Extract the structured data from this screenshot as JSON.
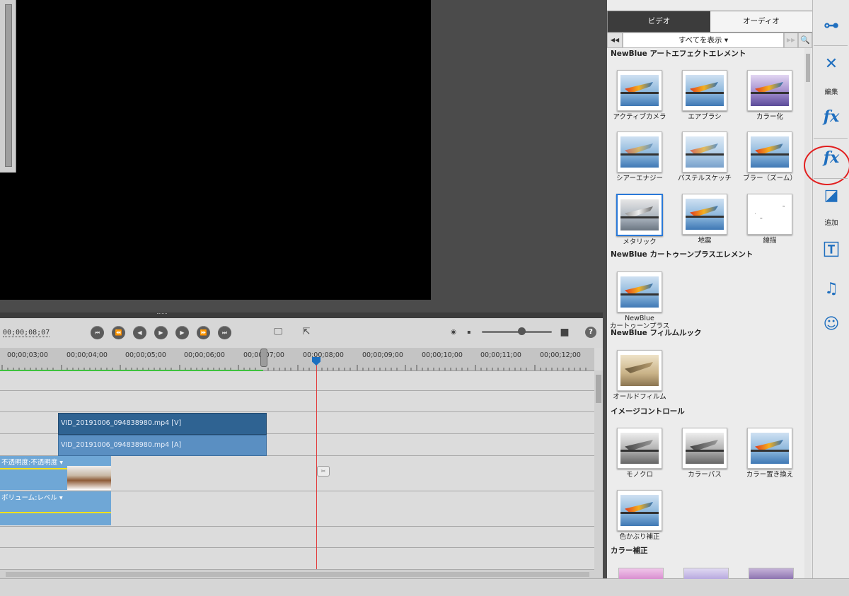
{
  "timecode": "00;00;08;07",
  "transport": {
    "buttons": [
      "⏮",
      "⏪",
      "◀",
      "▶",
      "▶",
      "⏩",
      "⏭"
    ]
  },
  "ruler": {
    "labels": [
      "00;00;03;00",
      "00;00;04;00",
      "00;00;05;00",
      "00;00;06;00",
      "00;00;07;00",
      "00;00;08;00",
      "00;00;09;00",
      "00;00;10;00",
      "00;00;11;00",
      "00;00;12;00"
    ]
  },
  "timeline": {
    "clip_video": "VID_20191006_094838980.mp4 [V]",
    "clip_audio": "VID_20191006_094838980.mp4 [A]",
    "clip_opacity": "不透明度:不透明度 ▾",
    "clip_volume": "ボリューム:レベル ▾"
  },
  "panel": {
    "tabs": {
      "video": "ビデオ",
      "audio": "オーディオ"
    },
    "filter": "すべてを表示 ▾",
    "sections": [
      {
        "title": "NewBlue アートエフェクトエレメント"
      },
      {
        "title": "NewBlue カートゥーンプラスエレメント"
      },
      {
        "title": "NewBlue フィルムルック"
      },
      {
        "title": "イメージコントロール"
      },
      {
        "title": "カラー補正"
      }
    ],
    "effects": {
      "art": [
        "アクティブカメラ",
        "エアブラシ",
        "カラー化",
        "シアーエナジー",
        "パステルスケッチ",
        "ブラー（ズーム）",
        "メタリック",
        "地震",
        "線描"
      ],
      "cartoon": [
        "NewBlue",
        "カートゥーンプラス"
      ],
      "film": [
        "オールドフィルム"
      ],
      "image": [
        "モノクロ",
        "カラーパス",
        "カラー置き換え",
        "色かぶり補正"
      ]
    }
  },
  "toolbar": {
    "label_edit": "編集",
    "label_add": "追加"
  },
  "colors": {
    "accent": "#1f6fbf",
    "playhead": "#e23b3b",
    "annotation": "#e21f1f"
  }
}
